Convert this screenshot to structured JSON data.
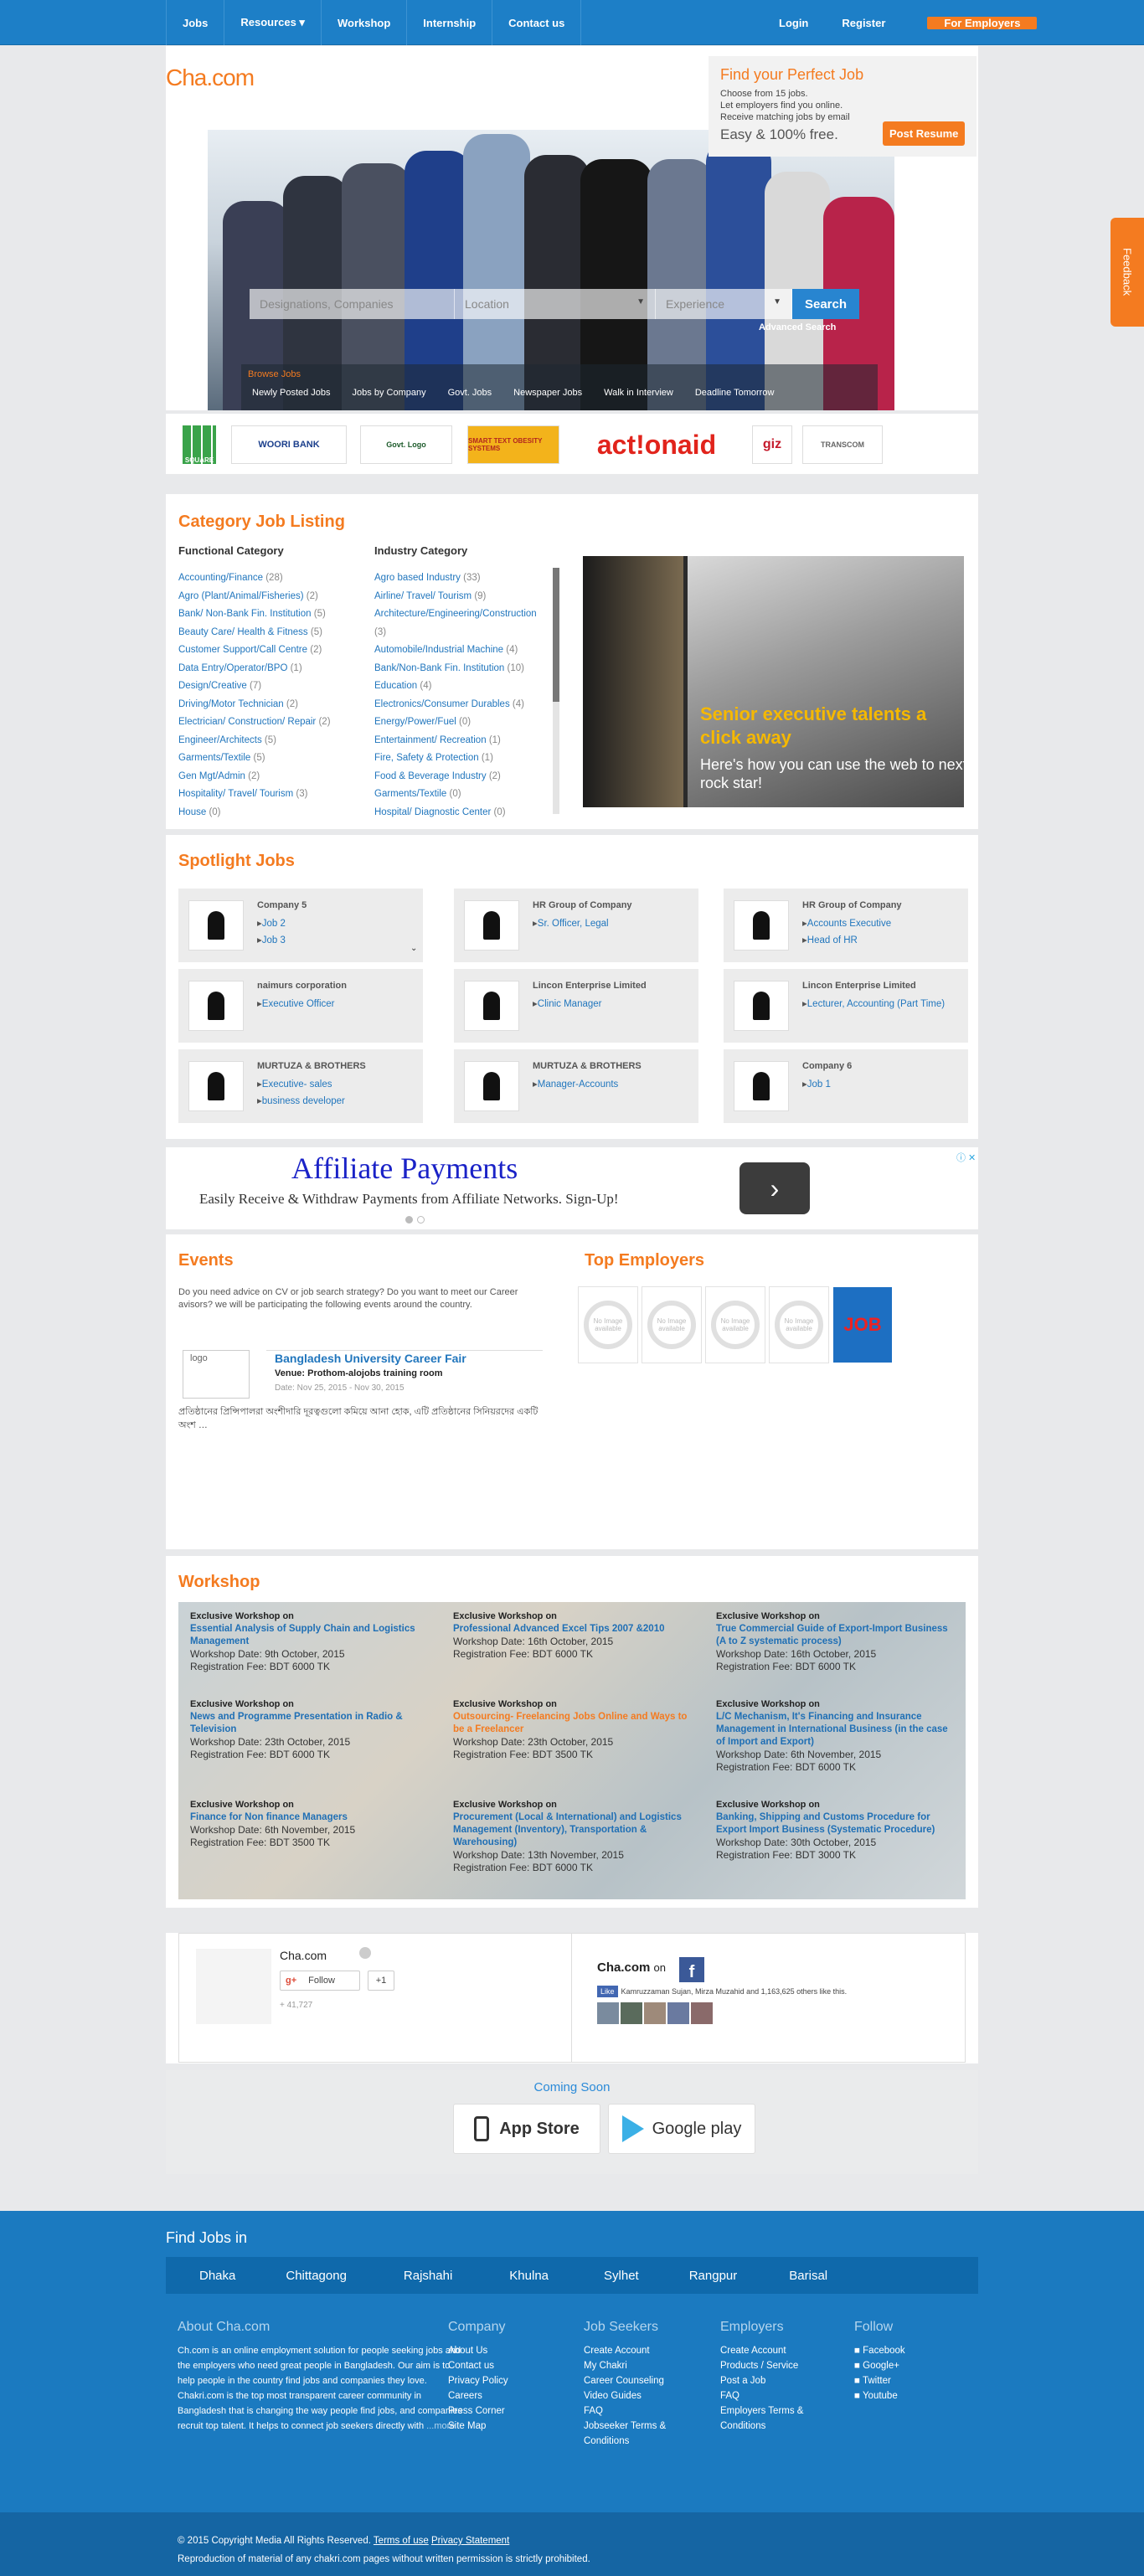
{
  "nav": {
    "items": [
      "Jobs",
      "Resources ▾",
      "Workshop",
      "Internship",
      "Contact us"
    ],
    "login": "Login",
    "register": "Register",
    "employers_btn": "For Employers"
  },
  "hero": {
    "logo": "Cha.com",
    "find_title": "Find your Perfect Job",
    "find_lines": [
      "Choose from 15 jobs.",
      "Let employers find you online.",
      "Receive matching jobs by email"
    ],
    "easy": "Easy & 100% free.",
    "post_resume": "Post Resume",
    "search": {
      "designations_placeholder": "Designations, Companies",
      "location_placeholder": "Location",
      "experience_placeholder": "Experience",
      "button": "Search",
      "advanced": "Advanced Search"
    },
    "browse_label": "Browse Jobs",
    "browse_items": [
      "Newly Posted Jobs",
      "Jobs by Company",
      "Govt. Jobs",
      "Newspaper Jobs",
      "Walk in Interview",
      "Deadline Tomorrow"
    ]
  },
  "feedback": "Feedback",
  "logos": [
    "SQUARE",
    "WOORI BANK",
    "Govt. Logo",
    "SMART TEXT OBESITY SYSTEMS",
    "act!onaid",
    "giz",
    "TRANSCOM"
  ],
  "category": {
    "title": "Category Job Listing",
    "functional_title": "Functional Category",
    "industry_title": "Industry Category",
    "functional": [
      {
        "name": "Accounting/Finance",
        "count": "(28)"
      },
      {
        "name": "Agro (Plant/Animal/Fisheries)",
        "count": "(2)"
      },
      {
        "name": "Bank/ Non-Bank Fin. Institution",
        "count": "(5)"
      },
      {
        "name": "Beauty Care/ Health & Fitness",
        "count": "(5)"
      },
      {
        "name": "Customer Support/Call Centre",
        "count": "(2)"
      },
      {
        "name": "Data Entry/Operator/BPO",
        "count": "(1)"
      },
      {
        "name": "Design/Creative",
        "count": "(7)"
      },
      {
        "name": "Driving/Motor Technician",
        "count": "(2)"
      },
      {
        "name": "Electrician/ Construction/ Repair",
        "count": "(2)"
      },
      {
        "name": "Engineer/Architects",
        "count": "(5)"
      },
      {
        "name": "Garments/Textile",
        "count": "(5)"
      },
      {
        "name": "Gen Mgt/Admin",
        "count": "(2)"
      },
      {
        "name": "Hospitality/ Travel/ Tourism",
        "count": "(3)"
      },
      {
        "name": "House",
        "count": "(0)"
      }
    ],
    "industry": [
      {
        "name": "Agro based Industry",
        "count": "(33)"
      },
      {
        "name": "Airline/ Travel/ Tourism",
        "count": "(9)"
      },
      {
        "name": "Architecture/Engineering/Construction",
        "count": "(3)"
      },
      {
        "name": "Automobile/Industrial Machine",
        "count": "(4)"
      },
      {
        "name": "Bank/Non-Bank Fin. Institution",
        "count": "(10)"
      },
      {
        "name": "Education",
        "count": "(4)"
      },
      {
        "name": "Electronics/Consumer Durables",
        "count": "(4)"
      },
      {
        "name": "Energy/Power/Fuel",
        "count": "(0)"
      },
      {
        "name": "Entertainment/ Recreation",
        "count": "(1)"
      },
      {
        "name": "Fire, Safety & Protection",
        "count": "(1)"
      },
      {
        "name": "Food & Beverage Industry",
        "count": "(2)"
      },
      {
        "name": "Garments/Textile",
        "count": "(0)"
      },
      {
        "name": "Hospital/ Diagnostic Center",
        "count": "(0)"
      }
    ],
    "banner_title": "Senior executive talents a click away",
    "banner_sub": "Here's how you can use the web to next rock star!"
  },
  "spotlight": {
    "title": "Spotlight Jobs",
    "cards": [
      {
        "company": "Company 5",
        "jobs": [
          "Job 2",
          "Job 3"
        ]
      },
      {
        "company": "HR Group of Company",
        "jobs": [
          "Sr. Officer, Legal"
        ]
      },
      {
        "company": "HR Group of Company",
        "jobs": [
          "Accounts Executive",
          "Head of HR"
        ]
      },
      {
        "company": "naimurs corporation",
        "jobs": [
          "Executive Officer"
        ]
      },
      {
        "company": "Lincon Enterprise Limited",
        "jobs": [
          "Clinic Manager"
        ]
      },
      {
        "company": "Lincon Enterprise Limited",
        "jobs": [
          "Lecturer, Accounting (Part Time)"
        ]
      },
      {
        "company": "MURTUZA & BROTHERS",
        "jobs": [
          "Executive- sales",
          "business developer"
        ]
      },
      {
        "company": "MURTUZA & BROTHERS",
        "jobs": [
          "Manager-Accounts"
        ]
      },
      {
        "company": "Company 6",
        "jobs": [
          "Job 1"
        ]
      }
    ]
  },
  "ad": {
    "headline": "Affiliate Payments",
    "sub": "Easily Receive & Withdraw Payments from Affiliate Networks. Sign-Up!"
  },
  "events": {
    "title": "Events",
    "intro": "Do you need advice on CV or job search strategy? Do you want to meet our Career avisors? we will be participating the following events around the country.",
    "logo_alt": "logo",
    "event_title": "Bangladesh University Career Fair",
    "venue_label": "Venue:",
    "venue": "Prothom-alojobs training room",
    "date": "Date: Nov 25, 2015 - Nov 30, 2015",
    "desc": "প্রতিষ্ঠানের প্রিন্সিপালরা অংশীদারি দূরত্বগুলো কমিয়ে আনা হোক, এটি প্রতিষ্ঠানের সিনিয়রদের একটি অংশ …"
  },
  "top_employers": {
    "title": "Top Employers",
    "no_image": "No Image available",
    "last": "JOB"
  },
  "workshop": {
    "title": "Workshop",
    "prefix": "Exclusive Workshop on",
    "items": [
      {
        "title": "Essential Analysis of Supply Chain and Logistics Management",
        "date": "Workshop Date: 9th October, 2015",
        "fee": "Registration Fee: BDT 6000 TK",
        "orange": false
      },
      {
        "title": "Professional Advanced Excel Tips 2007 &2010",
        "date": "Workshop Date: 16th October, 2015",
        "fee": "Registration Fee: BDT 6000 TK",
        "orange": false
      },
      {
        "title": "True Commercial Guide of Export-Import Business (A to Z systematic process)",
        "date": "Workshop Date: 16th October, 2015",
        "fee": "Registration Fee: BDT 6000 TK",
        "orange": false
      },
      {
        "title": "News and Programme Presentation in Radio & Television",
        "date": "Workshop Date: 23th October, 2015",
        "fee": "Registration Fee: BDT 6000 TK",
        "orange": false
      },
      {
        "title": "Outsourcing- Freelancing Jobs Online and Ways to be a Freelancer",
        "date": "Workshop Date: 23th October, 2015",
        "fee": "Registration Fee: BDT 3500 TK",
        "orange": true
      },
      {
        "title": "L/C Mechanism, It's Financing and Insurance Management in International Business (in the case of Import and Export)",
        "date": "Workshop Date: 6th November, 2015",
        "fee": "Registration Fee: BDT 6000 TK",
        "orange": false
      },
      {
        "title": "Finance for Non finance Managers",
        "date": "Workshop Date: 6th November, 2015",
        "fee": "Registration Fee: BDT 3500 TK",
        "orange": false
      },
      {
        "title": "Procurement (Local & International) and Logistics Management (Inventory), Transportation & Warehousing)",
        "date": "Workshop Date: 13th November, 2015",
        "fee": "Registration Fee: BDT 6000 TK",
        "orange": false
      },
      {
        "title": "Banking, Shipping and Customs Procedure for Export Import Business (Systematic Procedure)",
        "date": "Workshop Date: 30th October, 2015",
        "fee": "Registration Fee: BDT 3000 TK",
        "orange": false
      }
    ]
  },
  "social": {
    "gplus_name": "Cha.com",
    "follow": "Follow",
    "plus1": "+1",
    "followers": "+ 41,727",
    "fb_title": "Cha.com",
    "fb_on": "on",
    "fb_like": "Like",
    "fb_text": "Kamruzzaman Sujan, Mirza Muzahid and 1,163,625 others like this."
  },
  "coming": {
    "label": "Coming Soon",
    "appstore": "App Store",
    "googleplay": "Google play"
  },
  "footer": {
    "find_in": "Find Jobs in",
    "cities": [
      "Dhaka",
      "Chittagong",
      "Rajshahi",
      "Khulna",
      "Sylhet",
      "Rangpur",
      "Barisal"
    ],
    "about_title": "About Cha.com",
    "about_text": "Ch.com is an online employment solution for people seeking jobs and the employers who need great people in Bangladesh. Our aim is to help people in the country find jobs and companies they love. Chakri.com is the top most transparent career community in Bangladesh that is changing the way people find jobs, and companies recruit top talent. It helps to connect job seekers directly with",
    "more": "...more",
    "company_title": "Company",
    "company_links": [
      "About Us",
      "Contact us",
      "Privacy Policy",
      "Careers",
      "Press Corner",
      "Site Map"
    ],
    "seekers_title": "Job Seekers",
    "seekers_links": [
      "Create Account",
      "My Chakri",
      "Career Counseling",
      "Video Guides",
      "FAQ",
      "Jobseeker Terms & Conditions"
    ],
    "employers_title": "Employers",
    "employers_links": [
      "Create Account",
      "Products / Service",
      "Post a Job",
      "FAQ",
      "Employers Terms & Conditions"
    ],
    "follow_title": "Follow",
    "follow_links": [
      "Facebook",
      "Google+",
      "Twitter",
      "Youtube"
    ],
    "copyright": "© 2015 Copyright Media     All Rights Reserved.",
    "terms": "Terms of use",
    "privacy": "Privacy Statement",
    "repro": "Reproduction of material of any chakri.com pages without written permission is strictly prohibited."
  }
}
